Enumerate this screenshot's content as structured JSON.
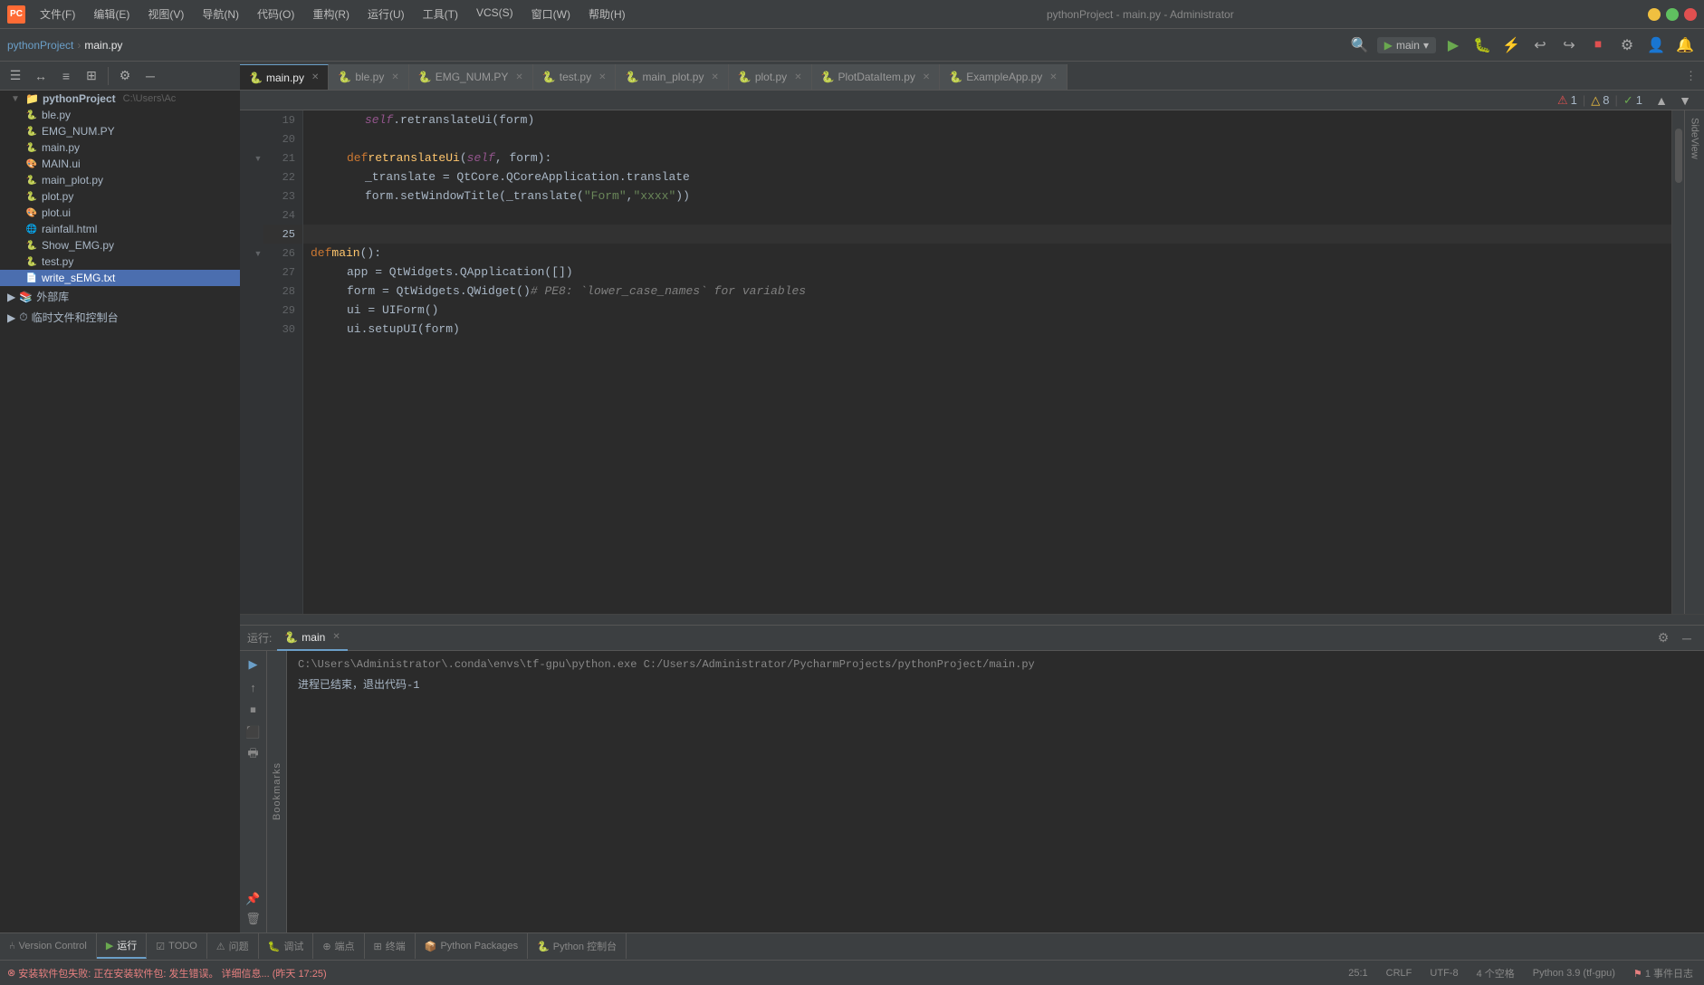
{
  "titleBar": {
    "logo": "PC",
    "menu": [
      "文件(F)",
      "编辑(E)",
      "视图(V)",
      "导航(N)",
      "代码(O)",
      "重构(R)",
      "运行(U)",
      "工具(T)",
      "VCS(S)",
      "窗口(W)",
      "帮助(H)"
    ],
    "title": "pythonProject - main.py - Administrator",
    "buttons": [
      "─",
      "□",
      "✕"
    ]
  },
  "breadcrumb": {
    "project": "pythonProject",
    "separator": "›",
    "file": "main.py"
  },
  "runConfig": {
    "icon": "▶",
    "label": "main",
    "dropdown": "▾"
  },
  "tabs": [
    {
      "name": "main.py",
      "active": true
    },
    {
      "name": "ble.py",
      "active": false
    },
    {
      "name": "EMG_NUM.PY",
      "active": false
    },
    {
      "name": "test.py",
      "active": false
    },
    {
      "name": "main_plot.py",
      "active": false
    },
    {
      "name": "plot.py",
      "active": false
    },
    {
      "name": "PlotDataItem.py",
      "active": false
    },
    {
      "name": "ExampleApp.py",
      "active": false
    }
  ],
  "errors": {
    "errorCount": "1",
    "warnCount": "8",
    "okCount": "1"
  },
  "fileTree": {
    "projectName": "pythonProject",
    "projectPath": "C:\\Users\\Ac",
    "files": [
      {
        "name": "ble.py",
        "type": "py",
        "indent": 1
      },
      {
        "name": "EMG_NUM.PY",
        "type": "py",
        "indent": 1
      },
      {
        "name": "main.py",
        "type": "py",
        "indent": 1
      },
      {
        "name": "MAIN.ui",
        "type": "ui",
        "indent": 1
      },
      {
        "name": "main_plot.py",
        "type": "py",
        "indent": 1
      },
      {
        "name": "plot.py",
        "type": "py",
        "indent": 1
      },
      {
        "name": "plot.ui",
        "type": "ui",
        "indent": 1
      },
      {
        "name": "rainfall.html",
        "type": "html",
        "indent": 1
      },
      {
        "name": "Show_EMG.py",
        "type": "py",
        "indent": 1
      },
      {
        "name": "test.py",
        "type": "py",
        "indent": 1
      },
      {
        "name": "write_sEMG.txt",
        "type": "txt",
        "indent": 1,
        "selected": true
      }
    ],
    "groups": [
      {
        "name": "外部库",
        "expanded": false
      },
      {
        "name": "临时文件和控制台",
        "expanded": false
      }
    ]
  },
  "codeLines": [
    {
      "num": 19,
      "indent": "indent3",
      "content": "self.retranslateUi(form)",
      "parts": [
        {
          "t": "self-kw",
          "v": "self"
        },
        {
          "t": "cls",
          "v": ".retranslateUi(form)"
        }
      ]
    },
    {
      "num": 20,
      "indent": "",
      "content": "",
      "parts": []
    },
    {
      "num": 21,
      "indent": "indent2",
      "content": "def retranslateUi(self, form):",
      "parts": [
        {
          "t": "kw",
          "v": "def "
        },
        {
          "t": "fn",
          "v": "retranslateUi"
        },
        {
          "t": "cls",
          "v": "("
        },
        {
          "t": "self-kw",
          "v": "self"
        },
        {
          "t": "cls",
          "v": ", form):"
        }
      ]
    },
    {
      "num": 22,
      "indent": "indent3",
      "content": "_translate = QtCore.QCoreApplication.translate",
      "parts": [
        {
          "t": "cls",
          "v": "_translate = QtCore.QCoreApplication.translate"
        }
      ]
    },
    {
      "num": 23,
      "indent": "indent3",
      "content": "form.setWindowTitle(_translate(\"Form\", \"xxxx\"))",
      "parts": [
        {
          "t": "cls",
          "v": "form.setWindowTitle(_translate("
        },
        {
          "t": "str",
          "v": "\"Form\""
        },
        {
          "t": "cls",
          "v": ", "
        },
        {
          "t": "str",
          "v": "\"xxxx\""
        },
        {
          "t": "cls",
          "v": "})"
        }
      ]
    },
    {
      "num": 24,
      "indent": "",
      "content": "",
      "parts": []
    },
    {
      "num": 25,
      "indent": "",
      "content": "",
      "parts": [],
      "current": true
    },
    {
      "num": 26,
      "indent": "",
      "content": "def main():",
      "parts": [
        {
          "t": "kw",
          "v": "def "
        },
        {
          "t": "fn",
          "v": "main"
        },
        {
          "t": "cls",
          "v": "():"
        }
      ]
    },
    {
      "num": 27,
      "indent": "indent2",
      "content": "app = QtWidgets.QApplication([])",
      "parts": [
        {
          "t": "cls",
          "v": "app = QtWidgets.QApplication([])"
        }
      ]
    },
    {
      "num": 28,
      "indent": "indent2",
      "content": "form = QtWidgets.QWidget()  # PE8: `lower_case_names` for variables",
      "parts": [
        {
          "t": "cls",
          "v": "form = QtWidgets.QWidget()  "
        },
        {
          "t": "comment",
          "v": "# PE8: `lower_case_names` for variables"
        }
      ]
    },
    {
      "num": 29,
      "indent": "indent2",
      "content": "ui = UIForm()",
      "parts": [
        {
          "t": "cls",
          "v": "ui = UIForm()"
        }
      ]
    },
    {
      "num": 30,
      "indent": "indent2",
      "content": "ui.setupUI(form)",
      "parts": [
        {
          "t": "cls",
          "v": "ui.setupUI(form)"
        }
      ]
    }
  ],
  "runPanel": {
    "label": "运行:",
    "activeTab": "main",
    "cmdLine": "C:\\Users\\Administrator\\.conda\\envs\\tf-gpu\\python.exe C:/Users/Administrator/PycharmProjects/pythonProject/main.py",
    "output": "进程已结束，退出代码-1"
  },
  "bottomTabs": [
    {
      "name": "Version Control",
      "icon": "⑃",
      "active": false
    },
    {
      "name": "运行",
      "icon": "▶",
      "active": true
    },
    {
      "name": "TODO",
      "icon": "☑",
      "active": false
    },
    {
      "name": "问题",
      "icon": "⚠",
      "active": false
    },
    {
      "name": "调试",
      "icon": "🐛",
      "active": false
    },
    {
      "name": "端点",
      "icon": "⊕",
      "active": false
    },
    {
      "name": "终端",
      "icon": "⊞",
      "active": false
    },
    {
      "name": "Python Packages",
      "icon": "📦",
      "active": false
    },
    {
      "name": "Python 控制台",
      "icon": "🐍",
      "active": false
    }
  ],
  "statusBar": {
    "installError": "安装软件包失败: 正在安装软件包: 发生错误。 详细信息... (昨天 17:25)",
    "errorIcon": "⊗",
    "position": "25:1",
    "lineEnding": "CRLF",
    "encoding": "UTF-8",
    "indent": "4 个空格",
    "pythonVersion": "Python 3.9 (tf-gpu)",
    "eventLog": "1 事件日志"
  }
}
